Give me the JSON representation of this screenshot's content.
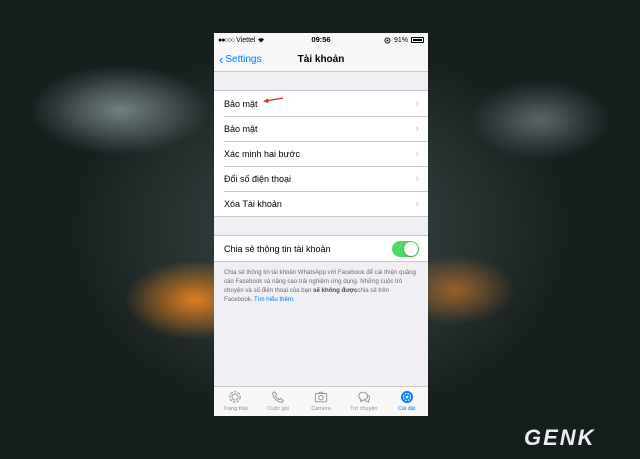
{
  "status_bar": {
    "carrier": "Viettel",
    "time": "09:56",
    "battery": "91%"
  },
  "nav": {
    "back_label": "Settings",
    "title": "Tài khoản"
  },
  "menu_items": [
    {
      "label": "Bảo mật"
    },
    {
      "label": "Bảo mật"
    },
    {
      "label": "Xác minh hai bước"
    },
    {
      "label": "Đổi số điện thoại"
    },
    {
      "label": "Xóa Tài khoản"
    }
  ],
  "share_setting": {
    "label": "Chia sẻ thông tin tài khoản",
    "enabled": true,
    "footnote_part1": "Chia sẻ thông tin tài khoản WhatsApp với Facebook để cải thiện quảng cáo Facebook và nâng cao trải nghiệm ứng dụng. Những cuộc trò chuyện và số điện thoại của bạn ",
    "footnote_bold": "sẽ không được",
    "footnote_part2": "chia sẻ trên Facebook. ",
    "footnote_link": "Tìm hiểu thêm."
  },
  "tabs": [
    {
      "label": "Trạng thái",
      "icon": "status-icon"
    },
    {
      "label": "Cuộc gọi",
      "icon": "phone-icon"
    },
    {
      "label": "Camera",
      "icon": "camera-icon"
    },
    {
      "label": "Trò chuyện",
      "icon": "chats-icon"
    },
    {
      "label": "Cài đặt",
      "icon": "settings-gear-icon",
      "active": true
    }
  ],
  "watermark": "GENK",
  "colors": {
    "accent": "#007aff",
    "toggle_on": "#4cd964",
    "annotation_arrow": "#e0261b"
  }
}
